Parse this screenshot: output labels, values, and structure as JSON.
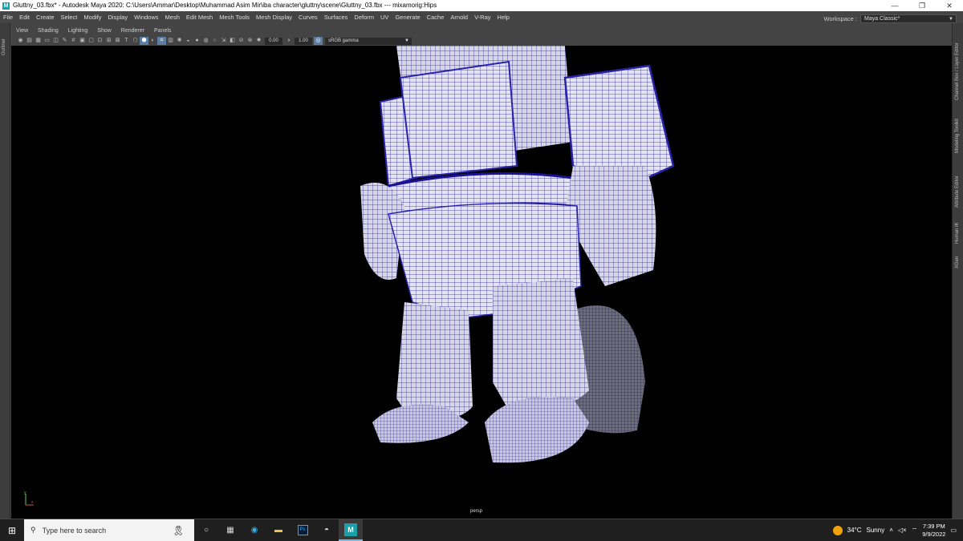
{
  "window": {
    "title": "Gluttny_03.fbx* - Autodesk Maya 2020: C:\\Users\\Ammar\\Desktop\\Muhammad Asim Mir\\iba character\\gluttny\\scene\\Gluttny_03.fbx  ---  mixamorig:Hips",
    "app_icon": "M",
    "minimize": "—",
    "maximize": "❐",
    "close": "✕"
  },
  "menubar": {
    "items": [
      "File",
      "Edit",
      "Create",
      "Select",
      "Modify",
      "Display",
      "Windows",
      "Mesh",
      "Edit Mesh",
      "Mesh Tools",
      "Mesh Display",
      "Curves",
      "Surfaces",
      "Deform",
      "UV",
      "Generate",
      "Cache",
      "Arnold",
      "V-Ray",
      "Help"
    ],
    "workspace_label": "Workspace :",
    "workspace_value": "Maya Classic*"
  },
  "left_panel": {
    "outliner_label": "Outliner"
  },
  "right_panel": {
    "tabs": [
      "Channel Box / Layer Editor",
      "Modeling Toolkit",
      "Attribute Editor",
      "Human IK",
      "XGen"
    ]
  },
  "panel_menu": {
    "items": [
      "View",
      "Shading",
      "Lighting",
      "Show",
      "Renderer",
      "Panels"
    ]
  },
  "viewport_toolbar": {
    "exposure": "0.00",
    "gamma": "1.00",
    "color_space": "sRGB gamma"
  },
  "viewport": {
    "camera_label": "persp",
    "axis_labels": [
      "y",
      "x"
    ]
  },
  "taskbar": {
    "search_placeholder": "Type here to search",
    "weather_temp": "34°C",
    "weather_text": "Sunny",
    "time": "7:39 PM",
    "date": "9/9/2022",
    "apps": [
      "task-view-icon",
      "widgets-icon",
      "edge-icon",
      "file-explorer-icon",
      "photoshop-icon",
      "app-icon",
      "maya-icon"
    ]
  },
  "colors": {
    "wire": "#2a22a8",
    "mesh": "#d9d9e8",
    "viewport_bg": "#000000",
    "ui_bg": "#444444"
  }
}
